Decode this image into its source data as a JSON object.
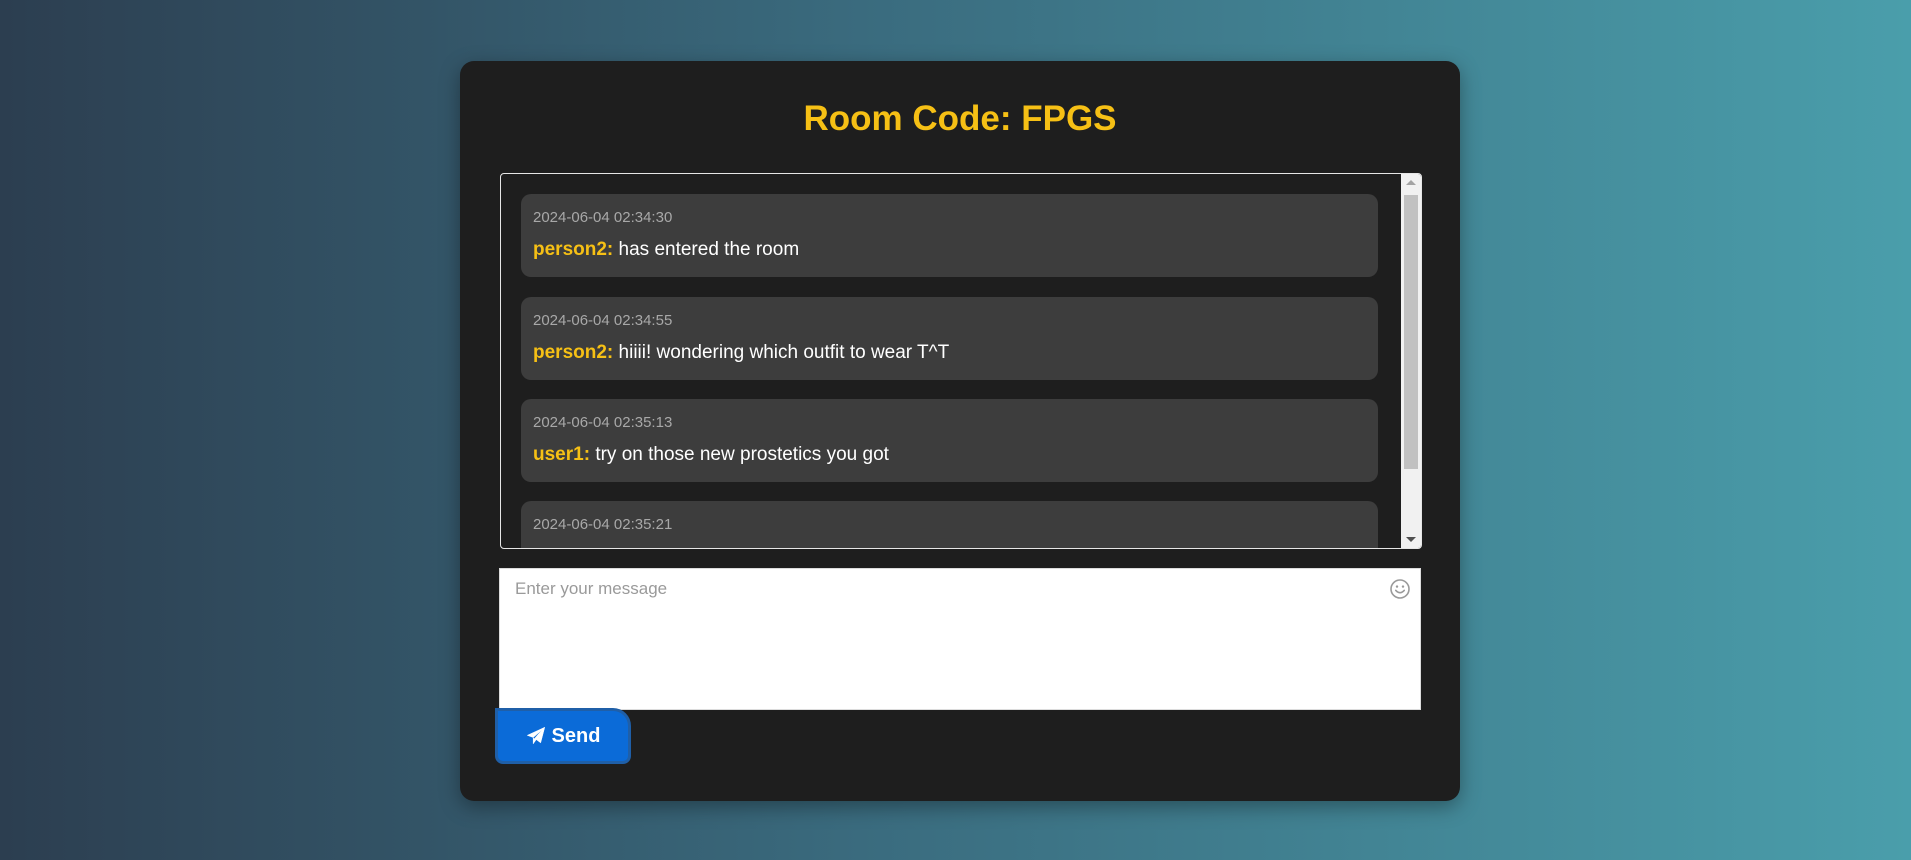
{
  "room": {
    "title": "Room Code: FPGS"
  },
  "messages": [
    {
      "timestamp": "2024-06-04 02:34:30",
      "user": "person2:",
      "text": "has entered the room"
    },
    {
      "timestamp": "2024-06-04 02:34:55",
      "user": "person2:",
      "text": "hiiii! wondering which outfit to wear T^T"
    },
    {
      "timestamp": "2024-06-04 02:35:13",
      "user": "user1:",
      "text": "try on those new prostetics you got"
    },
    {
      "timestamp": "2024-06-04 02:35:21",
      "user": "",
      "text": ""
    }
  ],
  "composer": {
    "placeholder": "Enter your message",
    "value": "",
    "emoji_icon": "smiley-icon",
    "send_label": "Send",
    "send_icon": "paper-plane-icon"
  },
  "colors": {
    "accent": "#f6c015",
    "panel": "#1e1e1e",
    "message_bg": "#3d3d3d",
    "send_button": "#0b6bd8"
  }
}
